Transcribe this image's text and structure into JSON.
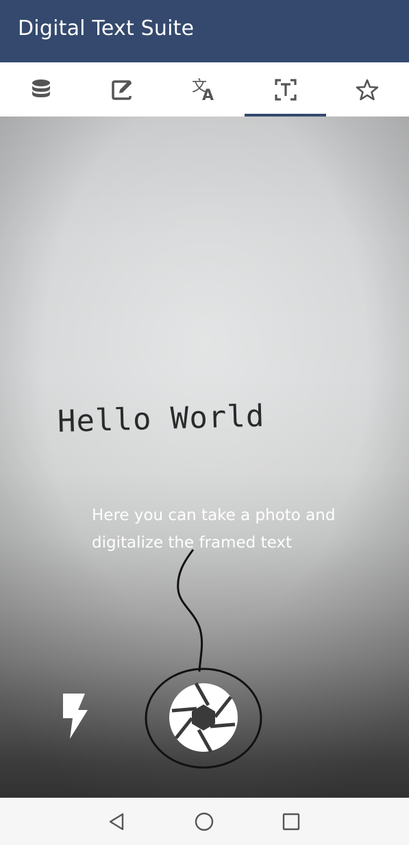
{
  "app_bar": {
    "title": "Digital Text Suite",
    "background": "#34496d"
  },
  "tabs": [
    {
      "icon": "database-icon",
      "selected": false
    },
    {
      "icon": "edit-icon",
      "selected": false
    },
    {
      "icon": "translate-icon",
      "selected": false
    },
    {
      "icon": "text-recognition-icon",
      "selected": true
    },
    {
      "icon": "star-icon",
      "selected": false
    }
  ],
  "camera": {
    "captured_text": "Hello World",
    "hint_lines": [
      "Here you can take a photo and",
      "digitalize the framed text"
    ],
    "flash_icon": "flash-icon",
    "shutter_icon": "aperture-shutter-icon"
  },
  "nav_bar": {
    "back_icon": "back-triangle-icon",
    "home_icon": "home-circle-icon",
    "recents_icon": "recents-square-icon"
  },
  "colors": {
    "accent": "#34496d",
    "icon_gray": "#555555"
  }
}
